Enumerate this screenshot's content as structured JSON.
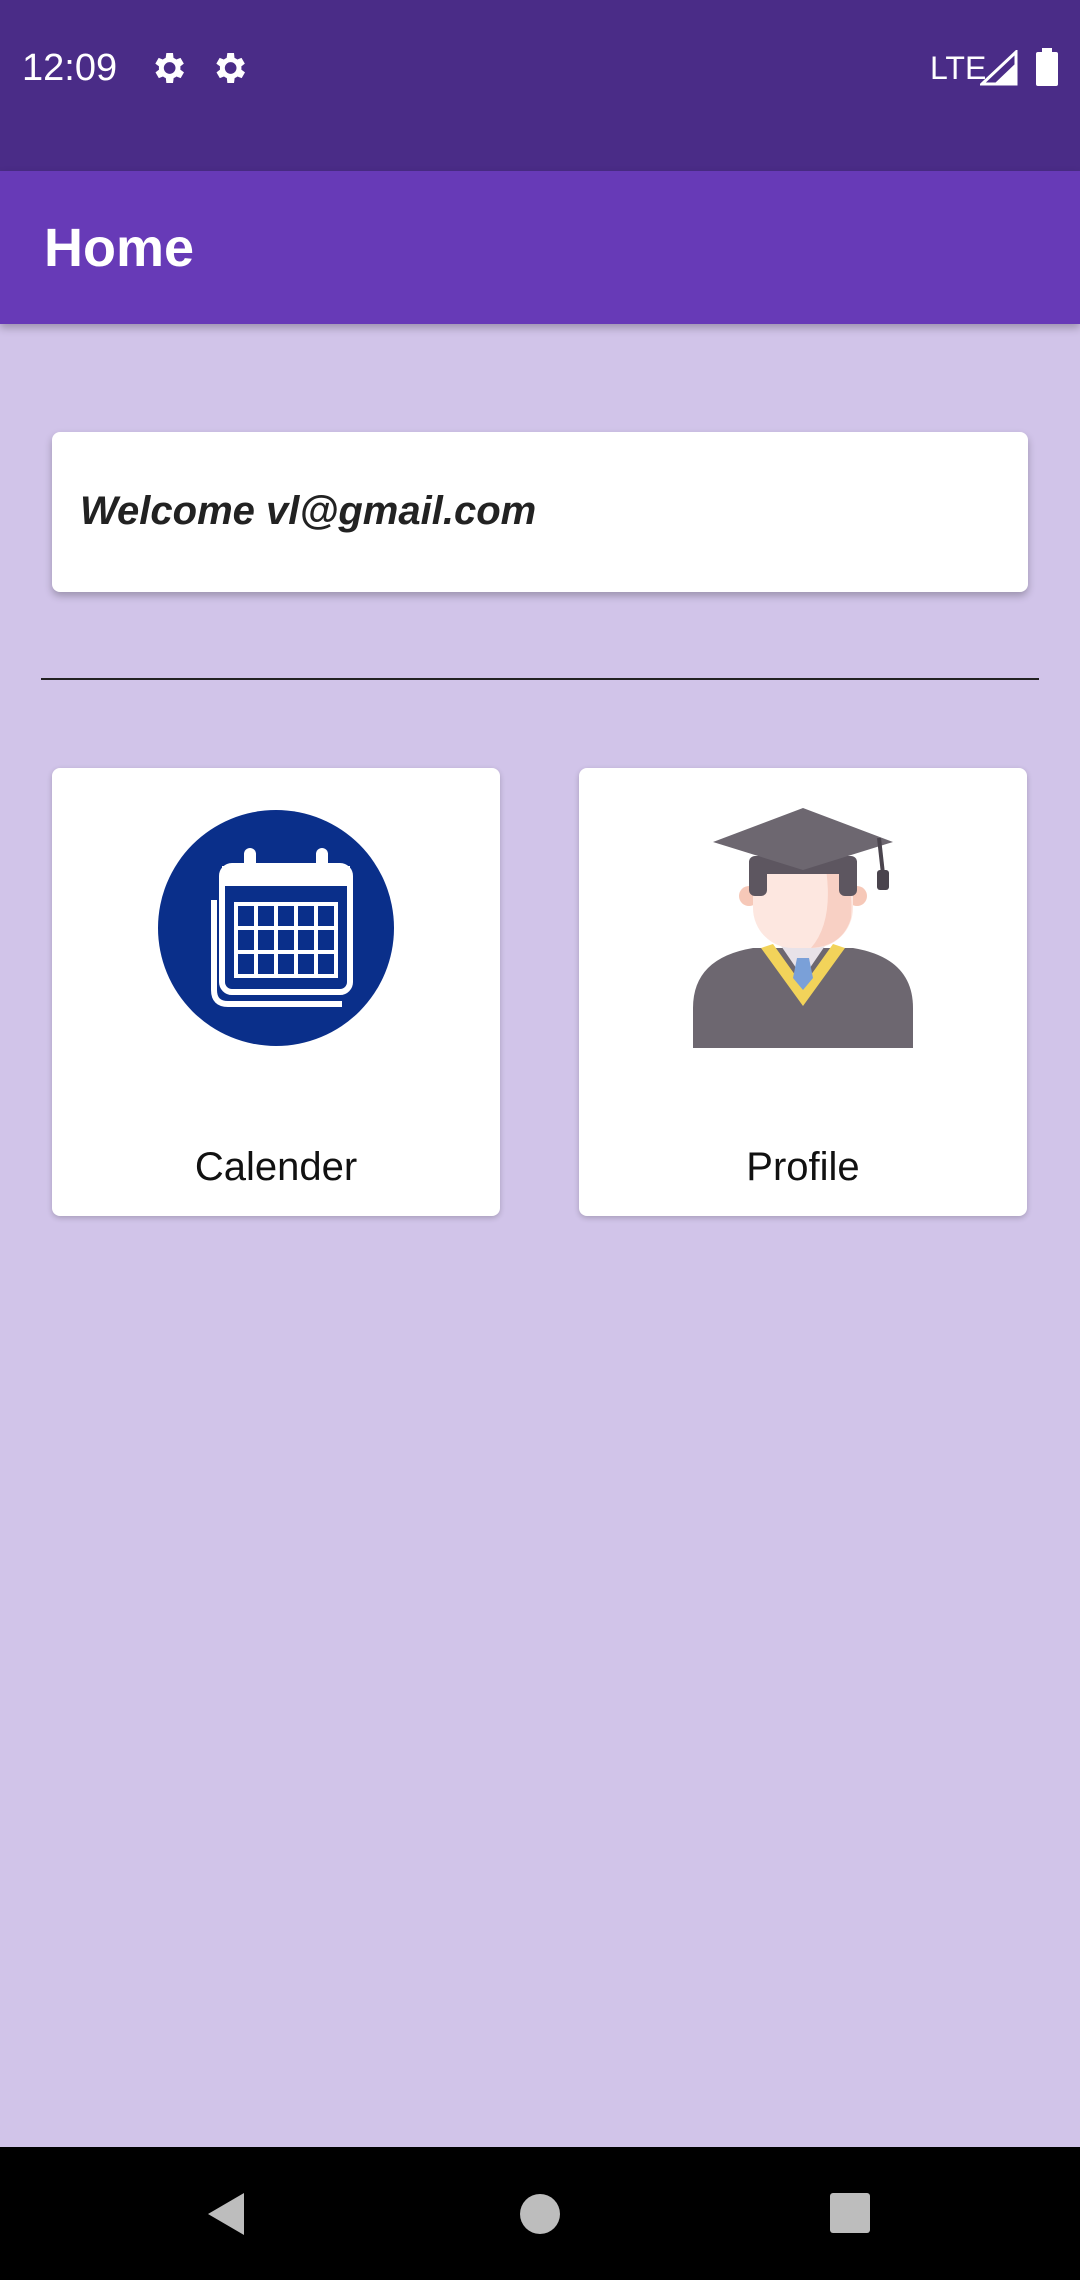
{
  "status_bar": {
    "time": "12:09",
    "network": "LTE",
    "icons": [
      "gear-icon",
      "gear-icon",
      "signal-icon",
      "battery-icon"
    ]
  },
  "app_bar": {
    "title": "Home"
  },
  "welcome": {
    "text": "Welcome vl@gmail.com"
  },
  "tiles": [
    {
      "label": "Calender",
      "icon": "calendar-icon"
    },
    {
      "label": "Profile",
      "icon": "graduate-avatar-icon"
    }
  ],
  "nav_bar": {
    "icons": [
      "back-icon",
      "home-icon",
      "recents-icon"
    ]
  },
  "colors": {
    "status_bar": "#4a2c87",
    "app_bar": "#673ab7",
    "background": "#d1c4e9",
    "calendar_circle": "#0a2f8a"
  }
}
